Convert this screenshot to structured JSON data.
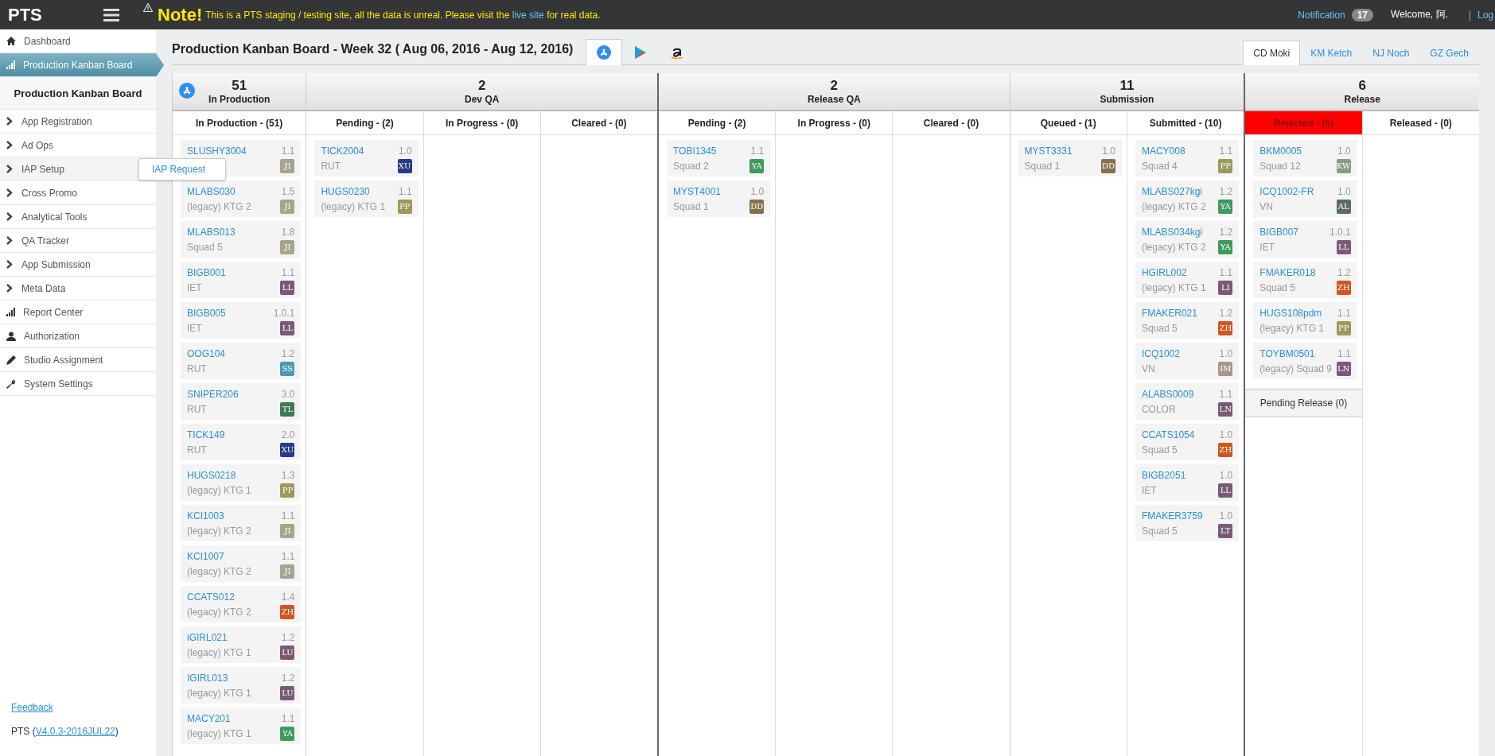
{
  "topbar": {
    "logo": "PTS",
    "note_title": "Note!",
    "note_before": "This is a PTS staging / testing site, all the data is unreal. Please visit the",
    "note_link": "live site",
    "note_after": "for real data.",
    "notification": "Notification",
    "notification_count": "17",
    "welcome": "Welcome, 阿.",
    "separator": "|",
    "logout": "Log"
  },
  "sidebar": {
    "items": [
      {
        "label": "Dashboard",
        "selected": false
      },
      {
        "label": "Production Kanban Board",
        "selected": true,
        "submenu": [
          "Production Kanban Board"
        ]
      },
      {
        "label": "App Registration",
        "selected": false
      },
      {
        "label": "Ad Ops",
        "selected": false
      },
      {
        "label": "IAP Setup",
        "selected": false,
        "flyout": [
          "IAP Request"
        ]
      },
      {
        "label": "Cross Promo",
        "selected": false
      },
      {
        "label": "Analytical Tools",
        "selected": false
      },
      {
        "label": "QA Tracker",
        "selected": false
      },
      {
        "label": "App Submission",
        "selected": false
      },
      {
        "label": "Meta Data",
        "selected": false
      },
      {
        "label": "Report Center",
        "selected": false
      },
      {
        "label": "Authorization",
        "selected": false
      },
      {
        "label": "Studio Assignment",
        "selected": false
      },
      {
        "label": "System Settings",
        "selected": false
      }
    ],
    "feedback": "Feedback",
    "version_prefix": "PTS (",
    "version": "V4.0.3-2016JUL22",
    "version_suffix": ")"
  },
  "title": "Production Kanban Board - Week 32 ( Aug 06, 2016 - Aug 12, 2016)",
  "platform_tabs": [
    {
      "kind": "appstore",
      "selected": true
    },
    {
      "kind": "play",
      "selected": false
    },
    {
      "kind": "amazon",
      "selected": false
    }
  ],
  "studio_tabs": [
    {
      "label": "CD Moki",
      "selected": true
    },
    {
      "label": "KM Ketch",
      "selected": false
    },
    {
      "label": "NJ Noch",
      "selected": false
    },
    {
      "label": "GZ Gech",
      "selected": false
    }
  ],
  "stages": [
    {
      "count": "51",
      "name": "In Production",
      "lanes": [
        {
          "title": "In Production - (51)",
          "alert": false,
          "cards": [
            {
              "id": "SLUSHY3004",
              "version": "1.1",
              "initials": "JI",
              "color": "#a9a58a"
            },
            {
              "id": "MLABS030",
              "version": "1.5",
              "group": "(legacy) KTG 2",
              "initials": "JI",
              "color": "#a9a58a"
            },
            {
              "id": "MLABS013",
              "version": "1.8",
              "group": "Squad 5",
              "initials": "JI",
              "color": "#a9a58a"
            },
            {
              "id": "BIGB001",
              "version": "1.1",
              "group": "IET",
              "initials": "LL",
              "color": "#7a5a78"
            },
            {
              "id": "BIGB005",
              "version": "1.0.1",
              "group": "IET",
              "initials": "LL",
              "color": "#7a5a78"
            },
            {
              "id": "OOG104",
              "version": "1.2",
              "group": "RUT",
              "initials": "SS",
              "color": "#4a9ab8"
            },
            {
              "id": "SNIPER206",
              "version": "3.0",
              "group": "RUT",
              "initials": "TL",
              "color": "#3d7a5a"
            },
            {
              "id": "TICK149",
              "version": "2.0",
              "group": "RUT",
              "initials": "XU",
              "color": "#2a3a8a"
            },
            {
              "id": "HUGS0218",
              "version": "1.3",
              "group": "(legacy) KTG 1",
              "initials": "PP",
              "color": "#9a9a5a"
            },
            {
              "id": "KCI1003",
              "version": "1.1",
              "group": "(legacy) KTG 2",
              "initials": "JI",
              "color": "#a9a58a"
            },
            {
              "id": "KCI1007",
              "version": "1.1",
              "group": "(legacy) KTG 2",
              "initials": "JI",
              "color": "#a9a58a"
            },
            {
              "id": "CCATS012",
              "version": "1.4",
              "group": "(legacy) KTG 2",
              "initials": "ZH",
              "color": "#d0561e"
            },
            {
              "id": "iGIRL021",
              "version": "1.2",
              "group": "(legacy) KTG 1",
              "initials": "LU",
              "color": "#7a5a70"
            },
            {
              "id": "IGIRL013",
              "version": "1.2",
              "group": "(legacy) KTG 1",
              "initials": "LU",
              "color": "#7a5a70"
            },
            {
              "id": "MACY201",
              "version": "1.1",
              "group": "(legacy) KTG 1",
              "initials": "YA",
              "color": "#3e9a5e"
            }
          ]
        }
      ]
    },
    {
      "count": "2",
      "name": "Dev QA",
      "lanes": [
        {
          "title": "Pending - (2)",
          "alert": false,
          "cards": [
            {
              "id": "TICK2004",
              "version": "1.0",
              "group": "RUT",
              "initials": "XU",
              "color": "#2a3a8a"
            },
            {
              "id": "HUGS0230",
              "version": "1.1",
              "group": "(legacy) KTG 1",
              "initials": "PP",
              "color": "#9a9a5a"
            }
          ]
        },
        {
          "title": "In Progress - (0)",
          "alert": false
        },
        {
          "title": "Cleared - (0)",
          "alert": false
        }
      ]
    },
    {
      "count": "2",
      "name": "Release QA",
      "lanes": [
        {
          "title": "Pending - (2)",
          "alert": false,
          "cards": [
            {
              "id": "TOBI1345",
              "version": "1.1",
              "group": "Squad 2",
              "initials": "YA",
              "color": "#3e9a5e"
            },
            {
              "id": "MYST4001",
              "version": "1.0",
              "group": "Squad 1",
              "initials": "DD",
              "color": "#85704e"
            }
          ]
        },
        {
          "title": "In Progress - (0)",
          "alert": false
        },
        {
          "title": "Cleared - (0)",
          "alert": false
        }
      ]
    },
    {
      "count": "11",
      "name": "Submission",
      "lanes": [
        {
          "title": "Queued - (1)",
          "alert": false,
          "cards": [
            {
              "id": "MYST3331",
              "version": "1.0",
              "group": "Squad 1",
              "initials": "DD",
              "color": "#85704e"
            }
          ]
        },
        {
          "title": "Submitted - (10)",
          "alert": false,
          "cards": [
            {
              "id": "MACY008",
              "version": "1.1",
              "group": "Squad 4",
              "initials": "PP",
              "color": "#9a9a5a"
            },
            {
              "id": "MLABS027kgi",
              "version": "1.2",
              "group": "(legacy) KTG 2",
              "initials": "YA",
              "color": "#3e9a5e"
            },
            {
              "id": "MLABS034kgi",
              "version": "1.2",
              "group": "(legacy) KTG 2",
              "initials": "YA",
              "color": "#3e9a5e"
            },
            {
              "id": "HGIRL002",
              "version": "1.1",
              "group": "(legacy) KTG 1",
              "initials": "LI",
              "color": "#7a5a78"
            },
            {
              "id": "FMAKER021",
              "version": "1.2",
              "group": "Squad 5",
              "initials": "ZH",
              "color": "#d0561e"
            },
            {
              "id": "ICQ1002",
              "version": "1.0",
              "group": "VN",
              "initials": "IM",
              "color": "#a8968a"
            },
            {
              "id": "ALABS0009",
              "version": "1.1",
              "group": "COLOR",
              "initials": "LN",
              "color": "#7a5a78"
            },
            {
              "id": "CCATS1054",
              "version": "1.0",
              "group": "Squad 5",
              "initials": "ZH",
              "color": "#d0561e"
            },
            {
              "id": "BIGB2051",
              "version": "1.0",
              "group": "IET",
              "initials": "LL",
              "color": "#7a5a78"
            },
            {
              "id": "FMAKER3759",
              "version": "1.0",
              "group": "Squad 5",
              "initials": "LT",
              "color": "#7a5a78"
            }
          ]
        }
      ]
    },
    {
      "count": "6",
      "name": "Release",
      "lanes": [
        {
          "title": "Rejected - (6)",
          "alert": true,
          "cards": [
            {
              "id": "BKM0005",
              "version": "1.0",
              "group": "Squad 12",
              "initials": "KW",
              "color": "#8a9a8a"
            },
            {
              "id": "ICQ1002-FR",
              "version": "1.0",
              "group": "VN",
              "initials": "AL",
              "color": "#5a6a70"
            },
            {
              "id": "BIGB007",
              "version": "1.0.1",
              "group": "IET",
              "initials": "LL",
              "color": "#7a5a78"
            },
            {
              "id": "FMAKER018",
              "version": "1.2",
              "group": "Squad 5",
              "initials": "ZH",
              "color": "#d0561e"
            },
            {
              "id": "HUGS108pdm",
              "version": "1.1",
              "group": "(legacy) KTG 1",
              "initials": "PP",
              "color": "#9a9a5a"
            },
            {
              "id": "TOYBM0501",
              "version": "1.1",
              "group": "(legacy) Squad 9",
              "initials": "LN",
              "color": "#7a5a78"
            }
          ],
          "footer": "Pending Release (0)"
        },
        {
          "title": "Released - (0)",
          "alert": false
        }
      ]
    }
  ]
}
